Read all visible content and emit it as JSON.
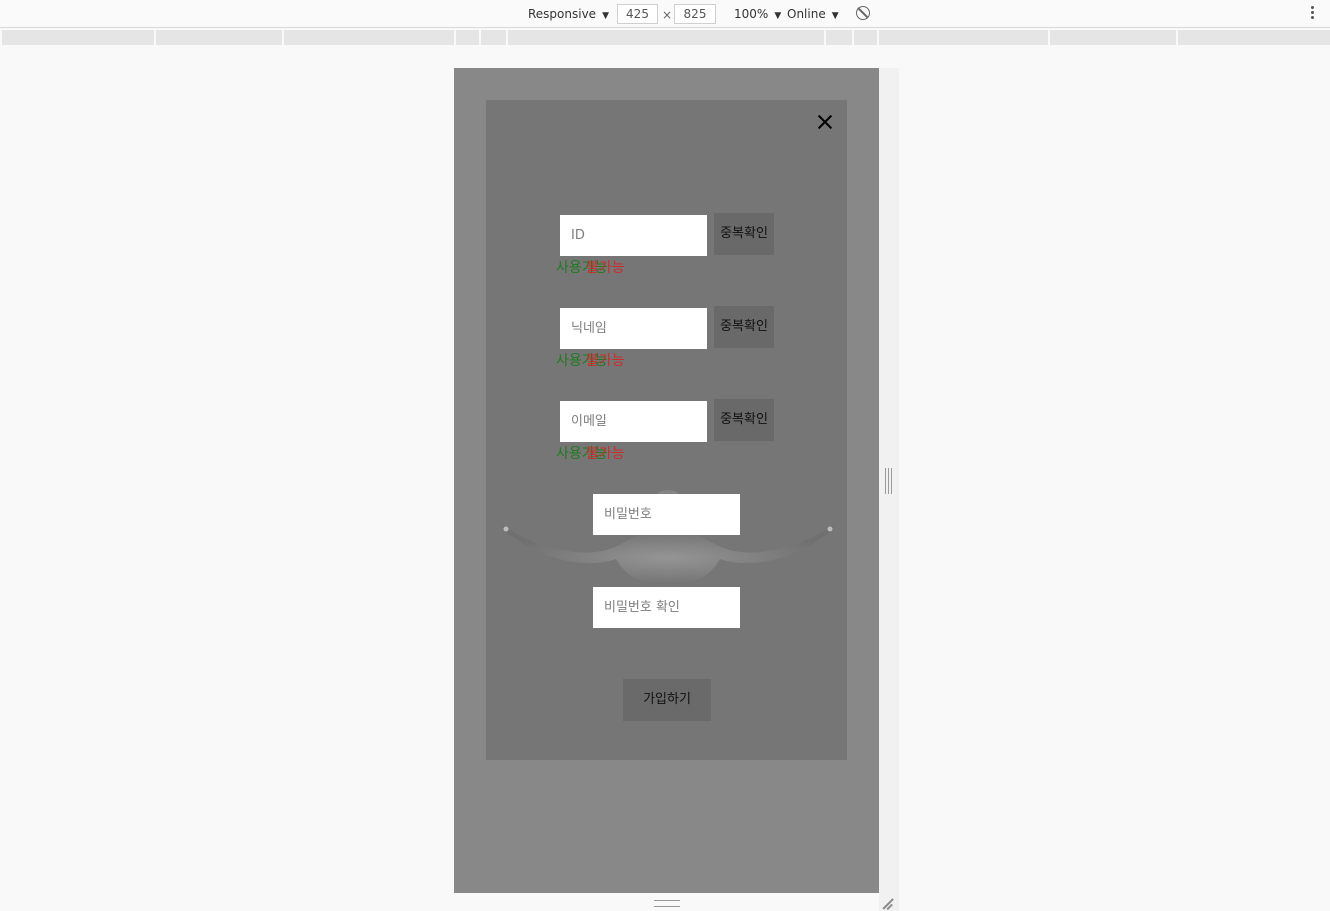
{
  "devtools": {
    "device_mode": "Responsive",
    "width": "425",
    "height": "825",
    "times": "×",
    "zoom": "100%",
    "network": "Online"
  },
  "signup_form": {
    "id_placeholder": "ID",
    "nickname_placeholder": "닉네임",
    "email_placeholder": "이메일",
    "password_placeholder": "비밀번호",
    "password_confirm_placeholder": "비밀번호 확인",
    "duplicate_check_label": "중복확인",
    "status_available": "사용가능",
    "status_unavailable": "불가능",
    "submit_label": "가입하기"
  },
  "colors": {
    "viewport_bg": "#888888",
    "modal_bg": "#767676",
    "available": "#1f7a1f",
    "unavailable": "#dd1f1f"
  }
}
